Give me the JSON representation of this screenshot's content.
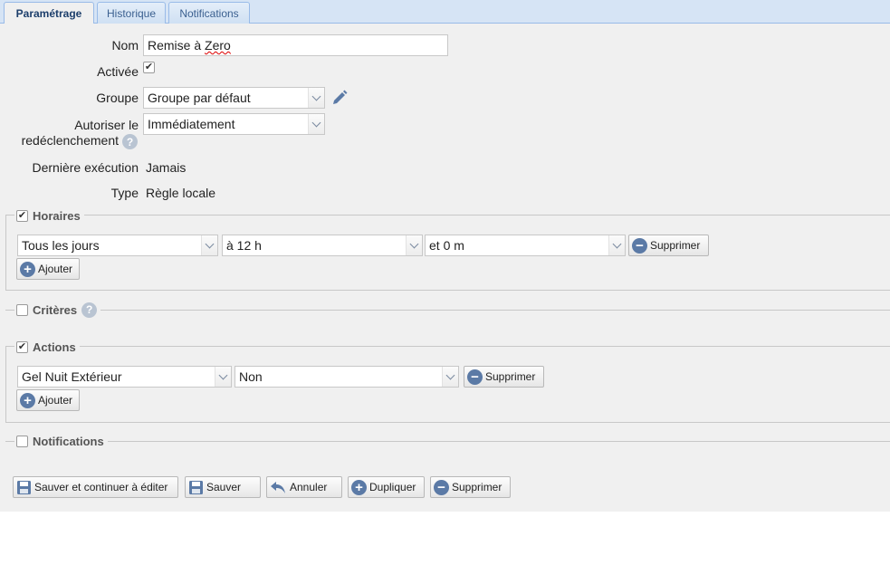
{
  "tabs": [
    {
      "label": "Paramétrage",
      "active": true
    },
    {
      "label": "Historique",
      "active": false
    },
    {
      "label": "Notifications",
      "active": false
    }
  ],
  "form": {
    "nom_label": "Nom",
    "nom_value_pre": "Remise à ",
    "nom_value_misspelled": "Zero",
    "activee_label": "Activée",
    "activee_checked": true,
    "groupe_label": "Groupe",
    "groupe_value": "Groupe par défaut",
    "redecl_label_1": "Autoriser le",
    "redecl_label_2": "redéclenchement",
    "redecl_value": "Immédiatement",
    "derniere_label": "Dernière exécution",
    "derniere_value": "Jamais",
    "type_label": "Type",
    "type_value": "Règle locale"
  },
  "horaires": {
    "legend": "Horaires",
    "checked": true,
    "row": {
      "jour": "Tous les jours",
      "heure": "à 12 h",
      "minute": "et 0 m",
      "remove_label": "Supprimer"
    },
    "add_label": "Ajouter"
  },
  "criteres": {
    "legend": "Critères",
    "checked": false
  },
  "actions": {
    "legend": "Actions",
    "checked": true,
    "row": {
      "action": "Gel Nuit Extérieur",
      "value": "Non",
      "remove_label": "Supprimer"
    },
    "add_label": "Ajouter"
  },
  "notifications": {
    "legend": "Notifications",
    "checked": false
  },
  "footer": {
    "save_continue": "Sauver et continuer à éditer",
    "save": "Sauver",
    "cancel": "Annuler",
    "duplicate": "Dupliquer",
    "delete": "Supprimer"
  },
  "icons": {
    "edit": "pencil-icon",
    "help": "help-icon",
    "save": "floppy-icon",
    "undo": "undo-icon",
    "add": "plus-circle-icon",
    "remove": "minus-circle-icon"
  },
  "colors": {
    "accent": "#5b7aa6",
    "tab_bar": "#d6e4f5",
    "panel": "#f0f0f0"
  }
}
